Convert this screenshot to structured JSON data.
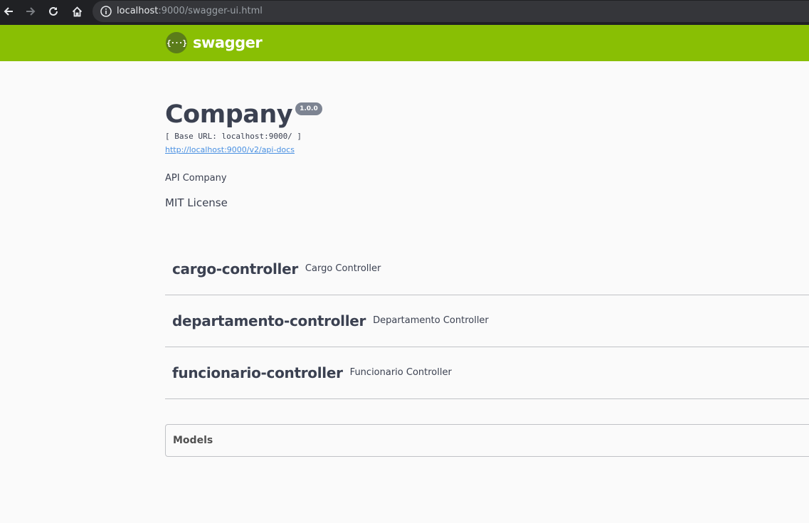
{
  "browser": {
    "url_host": "localhost",
    "url_path": ":9000/swagger-ui.html"
  },
  "topbar": {
    "logo_mark": "{···}",
    "logo_text": "swagger",
    "color": "#89bf04"
  },
  "info": {
    "title": "Company",
    "version": "1.0.0",
    "base_url": "[ Base URL: localhost:9000/ ]",
    "docs_link": "http://localhost:9000/v2/api-docs",
    "description": "API Company",
    "license": "MIT License"
  },
  "controllers": [
    {
      "name": "cargo-controller",
      "description": "Cargo Controller"
    },
    {
      "name": "departamento-controller",
      "description": "Departamento Controller"
    },
    {
      "name": "funcionario-controller",
      "description": "Funcionario Controller"
    }
  ],
  "models": {
    "title": "Models"
  },
  "icons": {
    "back": "arrow-left-icon",
    "forward": "arrow-right-icon",
    "reload": "reload-icon",
    "home": "home-icon",
    "info": "info-icon"
  }
}
